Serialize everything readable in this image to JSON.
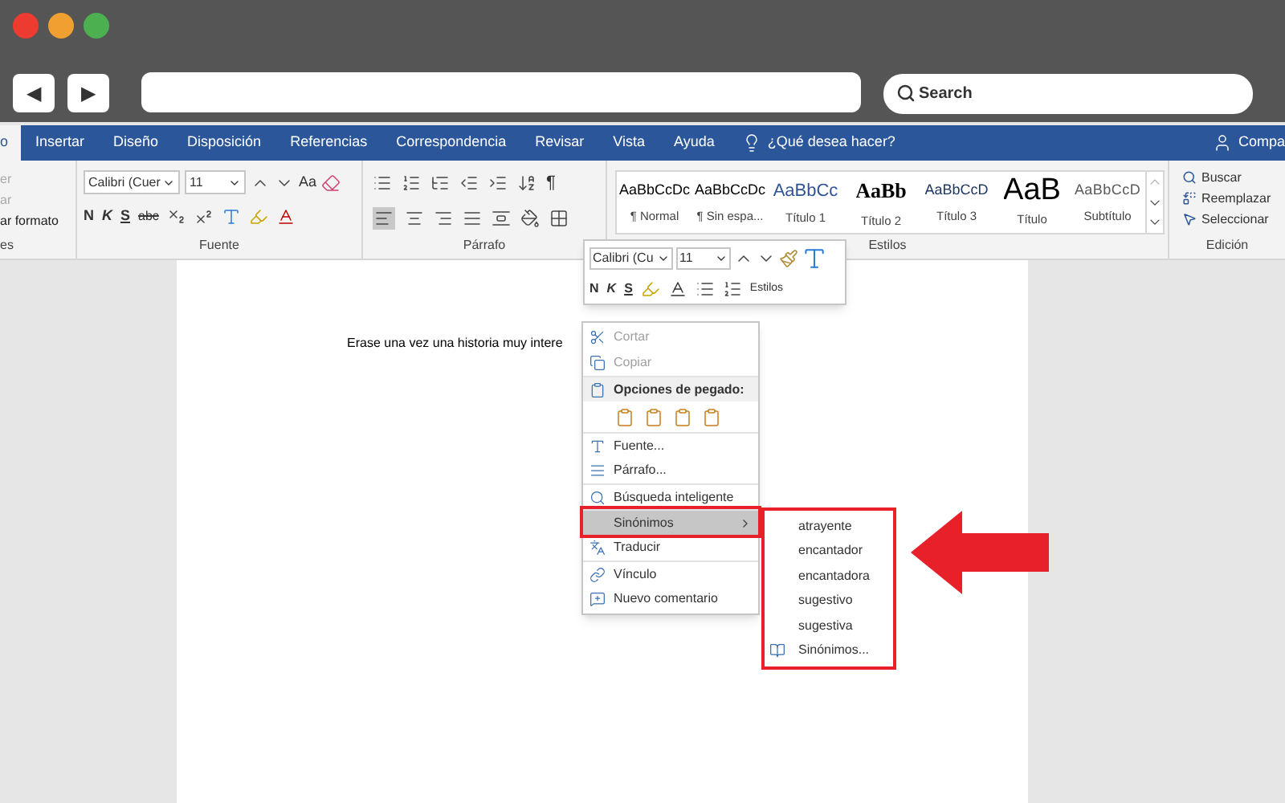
{
  "browser": {
    "back": "◀",
    "forward": "▶",
    "search_placeholder": "Search"
  },
  "ribbon_tabs": [
    {
      "label": "o",
      "selected": true
    },
    {
      "label": "Insertar",
      "selected": false
    },
    {
      "label": "Diseño",
      "selected": false
    },
    {
      "label": "Disposición",
      "selected": false
    },
    {
      "label": "Referencias",
      "selected": false
    },
    {
      "label": "Correspondencia",
      "selected": false
    },
    {
      "label": "Revisar",
      "selected": false
    },
    {
      "label": "Vista",
      "selected": false
    },
    {
      "label": "Ayuda",
      "selected": false
    }
  ],
  "tell_me": "¿Qué desea hacer?",
  "share": "Compa",
  "clipboard": {
    "items": [
      {
        "label": "er",
        "disabled": true
      },
      {
        "label": "ar",
        "disabled": true
      },
      {
        "label": "ar formato",
        "disabled": false
      }
    ],
    "group_label": "es"
  },
  "font_group": {
    "font": "Calibri (Cuer",
    "size": "11",
    "case": "Aa",
    "bold": "N",
    "italic": "K",
    "underline": "S",
    "strike": "abc",
    "group_label": "Fuente"
  },
  "paragraph_group": {
    "pilcrow": "¶",
    "group_label": "Párrafo"
  },
  "styles": {
    "items": [
      {
        "preview": "AaBbCcDc",
        "name": "¶ Normal",
        "kind": "normal"
      },
      {
        "preview": "AaBbCcDc",
        "name": "¶ Sin espa...",
        "kind": "normal"
      },
      {
        "preview": "AaBbCc",
        "name": "Título 1",
        "kind": "heading1"
      },
      {
        "preview": "AaBb",
        "name": "Título 2",
        "kind": "heading2"
      },
      {
        "preview": "AaBbCcD",
        "name": "Título 3",
        "kind": "heading3"
      },
      {
        "preview": "AaB",
        "name": "Título",
        "kind": "title"
      },
      {
        "preview": "AaBbCcD",
        "name": "Subtítulo",
        "kind": "subtitle"
      }
    ],
    "group_label": "Estilos"
  },
  "editing": {
    "items": [
      {
        "label": "Buscar",
        "kind": "find"
      },
      {
        "label": "Reemplazar",
        "kind": "replace"
      },
      {
        "label": "Seleccionar",
        "kind": "select"
      }
    ],
    "group_label": "Edición"
  },
  "document": {
    "text": "Erase una vez una historia muy intere"
  },
  "mini_toolbar": {
    "font": "Calibri (Cu",
    "size": "11",
    "bold": "N",
    "italic": "K",
    "underline": "S",
    "styles": "Estilos"
  },
  "context_menu": [
    {
      "kind": "item",
      "label": "Cortar",
      "disabled": true,
      "selected": false,
      "highlighted": false
    },
    {
      "kind": "item",
      "label": "Copiar",
      "disabled": true,
      "selected": false,
      "highlighted": false
    },
    {
      "kind": "header",
      "label": "Opciones de pegado:"
    },
    {
      "kind": "paste_options"
    },
    {
      "kind": "item",
      "label": "Fuente...",
      "disabled": false,
      "selected": false,
      "highlighted": false
    },
    {
      "kind": "item",
      "label": "Párrafo...",
      "disabled": false,
      "selected": false,
      "highlighted": false
    },
    {
      "kind": "item",
      "label": "Búsqueda inteligente",
      "disabled": false,
      "selected": false,
      "highlighted": false
    },
    {
      "kind": "submenu",
      "label": "Sinónimos",
      "disabled": false,
      "selected": true,
      "highlighted": true
    },
    {
      "kind": "item",
      "label": "Traducir",
      "disabled": false,
      "selected": false,
      "highlighted": false
    },
    {
      "kind": "item",
      "label": "Vínculo",
      "disabled": false,
      "selected": false,
      "highlighted": false
    },
    {
      "kind": "item",
      "label": "Nuevo comentario",
      "disabled": false,
      "selected": false,
      "highlighted": false
    }
  ],
  "submenu": {
    "highlighted": true,
    "items": [
      {
        "label": "atrayente",
        "kind": "word"
      },
      {
        "label": "encantador",
        "kind": "word"
      },
      {
        "label": "encantadora",
        "kind": "word"
      },
      {
        "label": "sugestivo",
        "kind": "word"
      },
      {
        "label": "sugestiva",
        "kind": "word"
      },
      {
        "label": "Sinónimos...",
        "kind": "thesaurus"
      }
    ]
  }
}
